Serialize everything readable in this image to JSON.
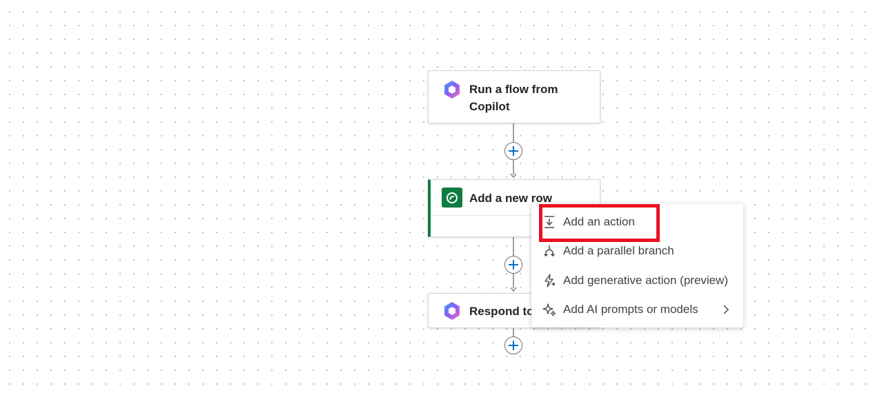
{
  "nodes": [
    {
      "title_line1": "Run a flow from",
      "title_line2": "Copilot",
      "icon": "copilot-icon"
    },
    {
      "title": "Add a new row",
      "icon": "dataverse-icon",
      "accent_color": "#107c41"
    },
    {
      "title": "Respond to",
      "icon": "copilot-icon"
    }
  ],
  "context_menu": {
    "items": [
      {
        "label": "Add an action",
        "icon": "add-action-icon"
      },
      {
        "label": "Add a parallel branch",
        "icon": "parallel-branch-icon"
      },
      {
        "label": "Add generative action (preview)",
        "icon": "generative-action-icon"
      },
      {
        "label": "Add AI prompts or models",
        "icon": "sparkle-icon",
        "has_submenu": true
      }
    ]
  },
  "colors": {
    "accent_plus": "#0f6cbd",
    "highlight": "#e81123",
    "dataverse_green": "#107c41"
  }
}
